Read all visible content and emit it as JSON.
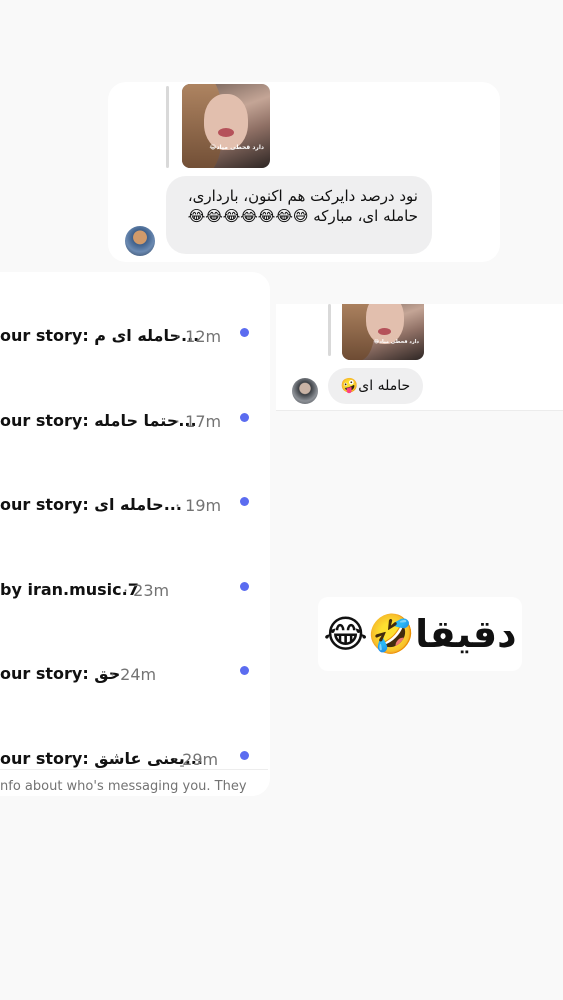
{
  "top_chat": {
    "story_caption": "دارد قحطی میاد😂",
    "message": "نود درصد دایرکت هم اکنون، بارداری، حامله ای، مبارکه 😅😂😂😂😂😂😂"
  },
  "inbox": {
    "rows": [
      {
        "preview": "our story: حامله ای م...",
        "time": "· 12m"
      },
      {
        "preview": "our story: حتما حامله...",
        "time": "· 17m"
      },
      {
        "preview": "our story: حامله ای...",
        "time": "· 19m"
      },
      {
        "preview": "by iran.music.7",
        "time": "· 23m"
      },
      {
        "preview": "our story: حق",
        "time": "· 24m"
      },
      {
        "preview": "our story: یعنی عاشق...",
        "time": "· 29m"
      }
    ],
    "footer": "nfo about who's messaging you. They"
  },
  "mid_chat": {
    "story_caption": "دارد قحطی میاد😂",
    "message": "حامله ای🤪"
  },
  "sticker_text": "دقیقا🤣😂",
  "colors": {
    "unread_dot": "#5b6cf0",
    "bubble": "#efeff0",
    "time": "#737373"
  }
}
